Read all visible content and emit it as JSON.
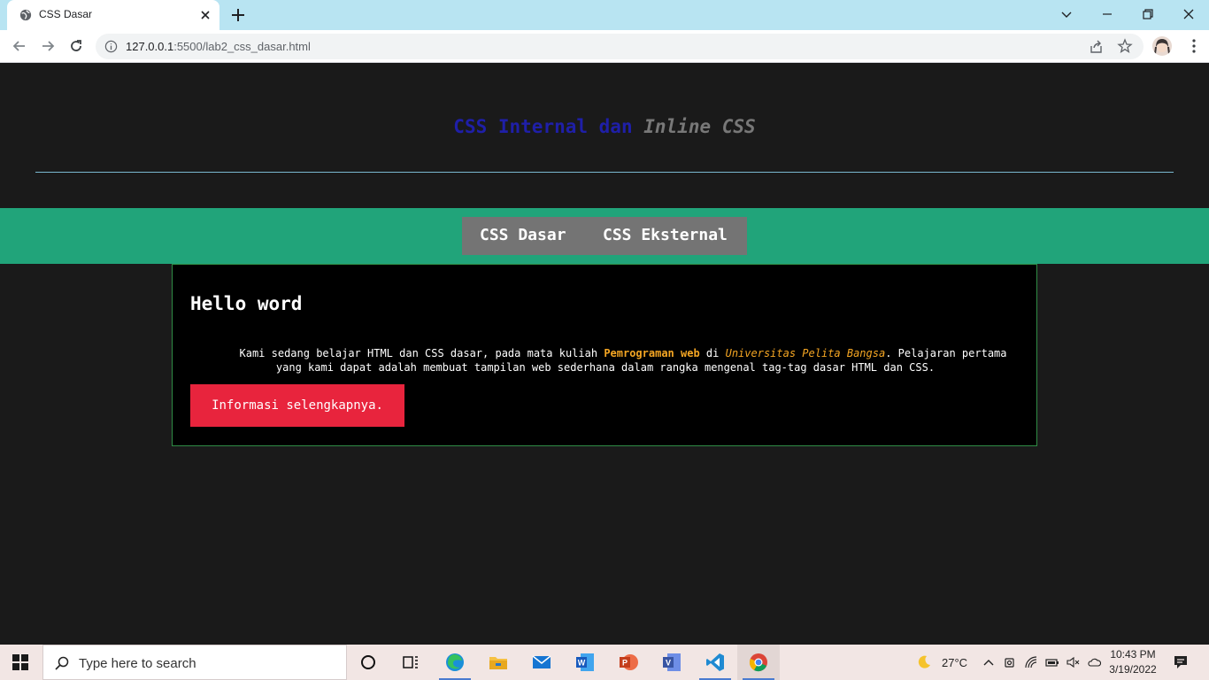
{
  "browser": {
    "tab_title": "CSS Dasar",
    "url_host": "127.0.0.1",
    "url_rest": ":5500/lab2_css_dasar.html"
  },
  "page": {
    "heading_blue": "CSS Internal dan",
    "heading_gray": "Inline CSS",
    "nav": [
      "CSS Dasar",
      "CSS Eksternal"
    ],
    "card": {
      "title": "Hello word",
      "text_1": "Kami sedang belajar HTML dan CSS dasar, pada mata kuliah ",
      "highlight_1": "Pemrograman web",
      "text_2": " di ",
      "highlight_2": "Universitas Pelita Bangsa",
      "text_3": ". Pelajaran pertama yang kami dapat adalah membuat tampilan web sederhana dalam rangka mengenal tag-tag dasar HTML dan CSS.",
      "button": "Informasi selengkapnya."
    },
    "colors": {
      "background": "#1a1a1a",
      "heading_blue": "#1f1fa8",
      "nav_band": "#21a47a",
      "nav_menu": "#747474",
      "accent_orange": "#f5a623",
      "button_red": "#e8243d"
    }
  },
  "taskbar": {
    "search_placeholder": "Type here to search",
    "weather": "27°C",
    "time": "10:43 PM",
    "date": "3/19/2022"
  }
}
